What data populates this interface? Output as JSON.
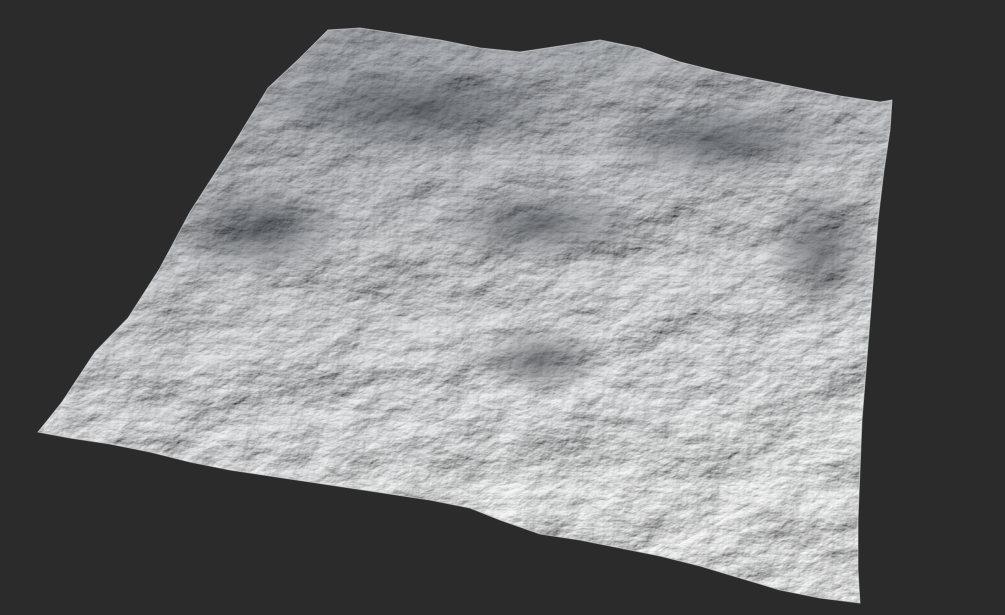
{
  "scene": {
    "background_color": "#2b2b2b",
    "terrain_base_color": "#b4bcc3",
    "terrain_highlight_color": "#eef1f3",
    "terrain_shadow_color": "#2c3038"
  }
}
